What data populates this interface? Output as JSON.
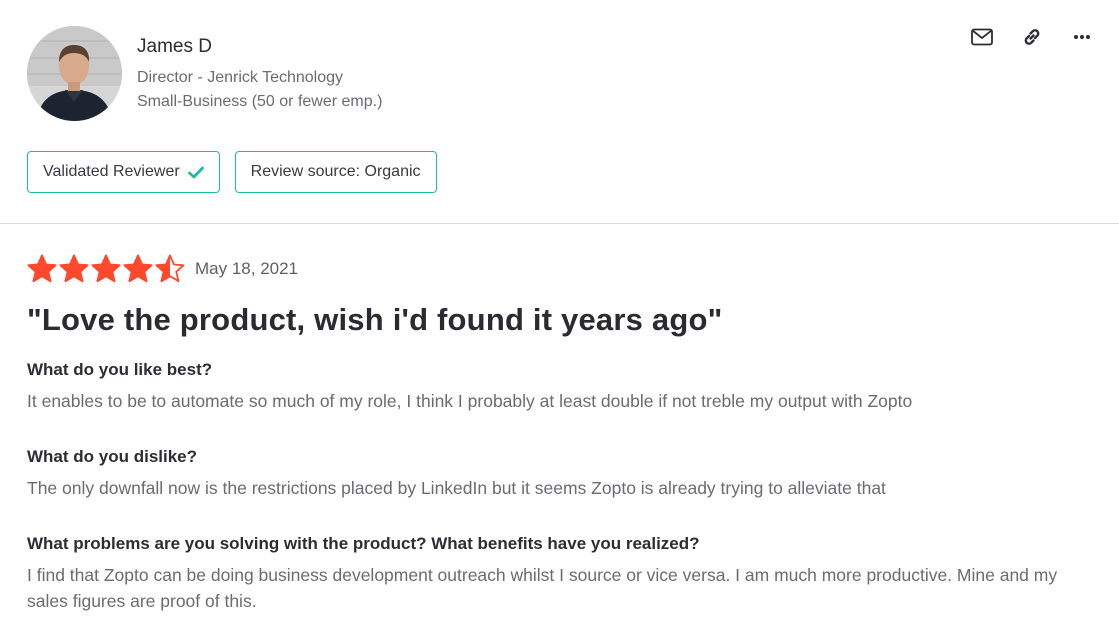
{
  "reviewer": {
    "name": "James D",
    "title": "Director - Jenrick Technology",
    "company_size": "Small-Business (50 or fewer emp.)"
  },
  "badges": {
    "validated": "Validated Reviewer",
    "source": "Review source: Organic"
  },
  "actions": [
    "mail-icon",
    "link-icon",
    "more-icon"
  ],
  "review": {
    "rating": 4.5,
    "rating_max": 5,
    "star_color": "#ff492c",
    "date": "May 18, 2021",
    "title": "\"Love the product, wish i'd found it years ago\"",
    "qa": [
      {
        "question": "What do you like best?",
        "answer": "It enables to be to automate so much of my role, I think I probably at least double if not treble my output with Zopto"
      },
      {
        "question": "What do you dislike?",
        "answer": "The only downfall now is the restrictions placed by LinkedIn but it seems Zopto is already trying to alleviate that"
      },
      {
        "question": "What problems are you solving with the product? What benefits have you realized?",
        "answer": "I find that Zopto can be doing business development outreach whilst I source or vice versa. I am much more productive. Mine and my sales figures are proof of this."
      }
    ]
  },
  "colors": {
    "accent_border": "#1fb7a5",
    "check": "#1fb7a5",
    "divider": "#d9d9d9"
  }
}
